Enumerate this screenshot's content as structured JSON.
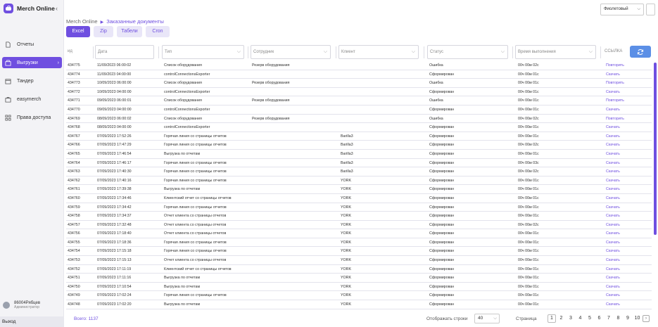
{
  "app": {
    "name": "Merch Online",
    "collapse_glyph": "‹"
  },
  "theme": {
    "selected": "Фиолетовый"
  },
  "sidebar": {
    "items": [
      {
        "label": "Отчеты",
        "icon": "file-icon",
        "active": false
      },
      {
        "label": "Выгрузки",
        "icon": "download-icon",
        "active": true
      },
      {
        "label": "Тандер",
        "icon": "store-icon",
        "active": false
      },
      {
        "label": "easymerch",
        "icon": "briefcase-icon",
        "active": false
      },
      {
        "label": "Права доступа",
        "icon": "grid-icon",
        "active": false
      }
    ],
    "user": {
      "name": "86004Рябцев",
      "role": "Администратор"
    },
    "logout": "Выход"
  },
  "breadcrumb": {
    "root": "Merch Online",
    "current": "Заказанные документы"
  },
  "tabs": [
    {
      "label": "Excel",
      "active": true
    },
    {
      "label": "Zip",
      "active": false
    },
    {
      "label": "Табели",
      "active": false
    },
    {
      "label": "Cron",
      "active": false
    }
  ],
  "filters": {
    "id": "ид",
    "date": "Дата",
    "type": "Тип",
    "employee": "Сотрудник",
    "client": "Клиент",
    "status": "Статус",
    "time": "Время выполнения",
    "link": "ССЫЛКА"
  },
  "rows": [
    [
      "434775",
      "11/09/2023 06:00:02",
      "Список оборудования",
      "Резерв оборудования",
      "",
      "Ошибка",
      "00ч 00м 02с",
      "Повторить"
    ],
    [
      "434774",
      "11/09/2023 04:00:00",
      "controlConnectionsExporter",
      "",
      "",
      "Сформирован",
      "00ч 00м 01с",
      "Скачать"
    ],
    [
      "434773",
      "10/09/2023 06:00:00",
      "Список оборудования",
      "Резерв оборудования",
      "",
      "Ошибка",
      "00ч 00м 01с",
      "Повторить"
    ],
    [
      "434772",
      "10/09/2023 04:00:00",
      "controlConnectionsExporter",
      "",
      "",
      "Сформирован",
      "00ч 00м 01с",
      "Скачать"
    ],
    [
      "434771",
      "09/09/2023 06:00:01",
      "Список оборудования",
      "Резерв оборудования",
      "",
      "Ошибка",
      "00ч 00м 01с",
      "Повторить"
    ],
    [
      "434770",
      "09/09/2023 04:00:00",
      "controlConnectionsExporter",
      "",
      "",
      "Сформирован",
      "00ч 00м 01с",
      "Скачать"
    ],
    [
      "434769",
      "08/09/2023 06:00:02",
      "Список оборудования",
      "Резерв оборудования",
      "",
      "Ошибка",
      "00ч 00м 02с",
      "Повторить"
    ],
    [
      "434768",
      "08/09/2023 04:00:00",
      "controlConnectionsExporter",
      "",
      "",
      "Сформирован",
      "00ч 00м 01с",
      "Скачать"
    ],
    [
      "434767",
      "07/09/2023 17:52:26",
      "Горячая линия со страницы отчетов",
      "",
      "Barilla3",
      "Сформирован",
      "00ч 00м 01с",
      "Скачать"
    ],
    [
      "434766",
      "07/09/2023 17:47:29",
      "Горячая линия со страницы отчетов",
      "",
      "Barilla3",
      "Сформирован",
      "00ч 00м 02с",
      "Скачать"
    ],
    [
      "434765",
      "07/09/2023 17:46:54",
      "Выгрузка по отчетам",
      "",
      "Barilla3",
      "Сформирован",
      "00ч 00м 01с",
      "Скачать"
    ],
    [
      "434764",
      "07/09/2023 17:46:17",
      "Горячая линия со страницы отчетов",
      "",
      "Barilla3",
      "Сформирован",
      "00ч 00м 03с",
      "Скачать"
    ],
    [
      "434763",
      "07/09/2023 17:40:30",
      "Горячая линия со страницы отчетов",
      "",
      "Barilla3",
      "Сформирован",
      "00ч 00м 02с",
      "Скачать"
    ],
    [
      "434762",
      "07/09/2023 17:40:16",
      "Горячая линия со страницы отчетов",
      "",
      "YORK",
      "Сформирован",
      "00ч 00м 01с",
      "Скачать"
    ],
    [
      "434761",
      "07/09/2023 17:39:38",
      "Выгрузка по отчетам",
      "",
      "YORK",
      "Сформирован",
      "00ч 00м 01с",
      "Скачать"
    ],
    [
      "434760",
      "07/09/2023 17:34:46",
      "Клиентский отчет со страницы отчетов",
      "",
      "YORK",
      "Сформирован",
      "00ч 00м 01с",
      "Скачать"
    ],
    [
      "434759",
      "07/09/2023 17:34:42",
      "Горячая линия со страницы отчетов",
      "",
      "YORK",
      "Сформирован",
      "00ч 00м 01с",
      "Скачать"
    ],
    [
      "434758",
      "07/09/2023 17:34:37",
      "Отчет клиента со страницы отчетов",
      "",
      "YORK",
      "Сформирован",
      "00ч 00м 01с",
      "Скачать"
    ],
    [
      "434757",
      "07/09/2023 17:32:48",
      "Отчет клиента со страницы отчетов",
      "",
      "YORK",
      "Сформирован",
      "00ч 00м 02с",
      "Скачать"
    ],
    [
      "434756",
      "07/09/2023 17:18:40",
      "Отчет клиента со страницы отчетов",
      "",
      "YORK",
      "Сформирован",
      "00ч 00м 01с",
      "Скачать"
    ],
    [
      "434755",
      "07/09/2023 17:18:36",
      "Горячая линия со страницы отчетов",
      "",
      "YORK",
      "Сформирован",
      "00ч 00м 01с",
      "Скачать"
    ],
    [
      "434754",
      "07/09/2023 17:15:18",
      "Горячая линия со страницы отчетов",
      "",
      "YORK",
      "Сформирован",
      "00ч 00м 01с",
      "Скачать"
    ],
    [
      "434753",
      "07/09/2023 17:15:13",
      "Отчет клиента со страницы отчетов",
      "",
      "YORK",
      "Сформирован",
      "00ч 00м 01с",
      "Скачать"
    ],
    [
      "434752",
      "07/09/2023 17:11:19",
      "Клиентский отчет со страницы отчетов",
      "",
      "YORK",
      "Сформирован",
      "00ч 00м 01с",
      "Скачать"
    ],
    [
      "434751",
      "07/09/2023 17:11:16",
      "Выгрузка по отчетам",
      "",
      "YORK",
      "Сформирован",
      "00ч 00м 01с",
      "Скачать"
    ],
    [
      "434750",
      "07/09/2023 17:10:54",
      "Выгрузка по отчетам",
      "",
      "YORK",
      "Сформирован",
      "00ч 00м 01с",
      "Скачать"
    ],
    [
      "434749",
      "07/09/2023 17:02:24",
      "Горячая линия со страницы отчетов",
      "",
      "YORK",
      "Сформирован",
      "00ч 00м 01с",
      "Скачать"
    ],
    [
      "434748",
      "07/09/2023 17:02:20",
      "Выгрузка по отчетам",
      "",
      "YORK",
      "Сформирован",
      "00ч 00м 01с",
      "Скачать"
    ]
  ],
  "footer": {
    "total": "Всего: 1137",
    "rows_label": "Отображать строки",
    "rows_per_page": "40",
    "page_label": "Страница",
    "pages": [
      "1",
      "2",
      "3",
      "4",
      "5",
      "6",
      "7",
      "8",
      "9",
      "10"
    ],
    "current_page": "1",
    "next_glyph": "›"
  },
  "colors": {
    "accent": "#6f4fe0",
    "refresh": "#5b8fe6"
  }
}
